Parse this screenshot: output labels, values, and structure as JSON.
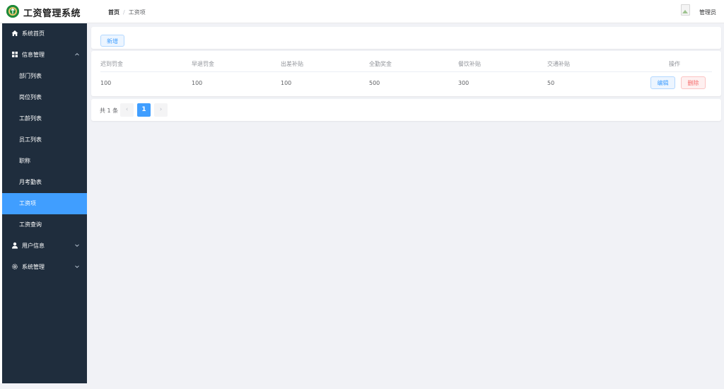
{
  "app": {
    "title": "工资管理系统",
    "user": "管理员"
  },
  "breadcrumb": {
    "home": "首页",
    "current": "工资项"
  },
  "sidebar": {
    "home": "系统首页",
    "info": "信息管理",
    "info_items": [
      "部门列表",
      "岗位列表",
      "工龄列表",
      "员工列表",
      "职称",
      "月考勤表",
      "工资项",
      "工资查询"
    ],
    "user": "用户信息",
    "system": "系统管理"
  },
  "toolbar": {
    "add_label": "新增"
  },
  "table": {
    "headers": [
      "迟到罚金",
      "早退罚金",
      "出差补贴",
      "全勤奖金",
      "餐饮补贴",
      "交通补贴",
      "操作"
    ],
    "rows": [
      {
        "cells": [
          "100",
          "100",
          "100",
          "500",
          "300",
          "50"
        ],
        "edit": "编辑",
        "delete": "删除"
      }
    ]
  },
  "pagination": {
    "total": "共 1 条",
    "prev": "‹",
    "page": "1",
    "next": "›"
  },
  "colors": {
    "primary": "#409eff",
    "sidebar": "#1f2d3d",
    "danger": "#f56c6c",
    "logo": "#1e8a3a"
  }
}
